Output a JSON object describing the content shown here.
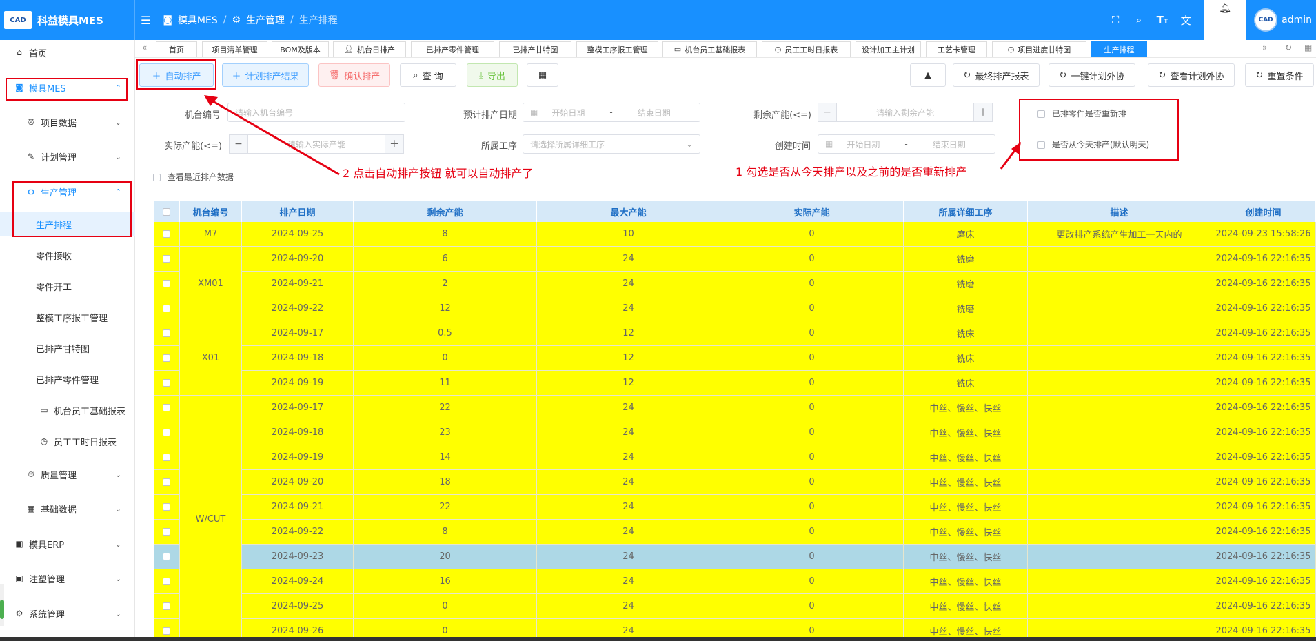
{
  "app": {
    "logo_mark": "CAD",
    "title": "科益模具MES",
    "user": "admin",
    "user_avatar": "CAD"
  },
  "breadcrumb": {
    "module": "模具MES",
    "section": "生产管理",
    "page": "生产排程"
  },
  "sidebar": {
    "home": "首页",
    "mes": "模具MES",
    "project_data": "项目数据",
    "plan_mgmt": "计划管理",
    "prod_mgmt": "生产管理",
    "prod_schedule": "生产排程",
    "part_receive": "零件接收",
    "part_start": "零件开工",
    "mold_report": "整模工序报工管理",
    "gantt": "已排产甘特图",
    "scheduled_parts": "已排产零件管理",
    "machine_staff": "机台员工基础报表",
    "staff_daily": "员工工时日报表",
    "quality": "质量管理",
    "basic_data": "基础数据",
    "erp": "模具ERP",
    "injection": "注塑管理",
    "system": "系统管理"
  },
  "tabs": [
    "首页",
    "项目清单管理",
    "BOM及版本",
    "机台日排产",
    "已排产零件管理",
    "已排产甘特图",
    "整模工序报工管理",
    "机台员工基础报表",
    "员工工时日报表",
    "设计加工主计划",
    "工艺卡管理",
    "项目进度甘特图",
    "生产排程"
  ],
  "toolbar": {
    "auto_schedule": "自动排产",
    "plan_result": "计划排产结果",
    "confirm": "确认排产",
    "query": "查 询",
    "export": "导出",
    "final_report": "最终排产报表",
    "outsource_one": "一键计划外协",
    "view_outsource": "查看计划外协",
    "reset": "重置条件"
  },
  "filters": {
    "machine_label": "机台编号",
    "machine_ph": "请输入机台编号",
    "date_label": "预计排产日期",
    "start_ph": "开始日期",
    "end_ph": "结束日期",
    "dash": "-",
    "remain_label": "剩余产能(<=)",
    "remain_ph": "请输入剩余产能",
    "actual_label": "实际产能(<=)",
    "actual_ph": "请输入实际产能",
    "process_label": "所属工序",
    "process_ph": "请选择所属详细工序",
    "create_label": "创建时间",
    "resched_label": "已排零件是否重新排",
    "today_label": "是否从今天排产(默认明天)",
    "recent_label": "查看最近排产数据"
  },
  "annotations": {
    "a1": "1 勾选是否从今天排产以及之前的是否重新排产",
    "a2": "2 点击自动排产按钮 就可以自动排产了"
  },
  "colors": {
    "primary": "#1890ff",
    "row_yellow": "#ffff00",
    "row_selected": "#add8e6",
    "annot": "#e60012"
  },
  "table": {
    "headers": [
      "机台编号",
      "排产日期",
      "剩余产能",
      "最大产能",
      "实际产能",
      "所属详细工序",
      "描述",
      "创建时间"
    ],
    "groups": [
      {
        "machine": "M7",
        "start": 0,
        "span": 1
      },
      {
        "machine": "XM01",
        "start": 1,
        "span": 3
      },
      {
        "machine": "X01",
        "start": 4,
        "span": 3
      },
      {
        "machine": "W/CUT",
        "start": 7,
        "span": 10
      }
    ],
    "rows": [
      {
        "date": "2024-09-25",
        "remain": "8",
        "max": "10",
        "actual": "0",
        "process": "磨床",
        "desc": "更改排产系统产生加工一天内的",
        "created": "2024-09-23 15:58:26"
      },
      {
        "date": "2024-09-20",
        "remain": "6",
        "max": "24",
        "actual": "0",
        "process": "铣磨",
        "desc": "",
        "created": "2024-09-16 22:16:35"
      },
      {
        "date": "2024-09-21",
        "remain": "2",
        "max": "24",
        "actual": "0",
        "process": "铣磨",
        "desc": "",
        "created": "2024-09-16 22:16:35"
      },
      {
        "date": "2024-09-22",
        "remain": "12",
        "max": "24",
        "actual": "0",
        "process": "铣磨",
        "desc": "",
        "created": "2024-09-16 22:16:35"
      },
      {
        "date": "2024-09-17",
        "remain": "0.5",
        "max": "12",
        "actual": "0",
        "process": "铣床",
        "desc": "",
        "created": "2024-09-16 22:16:35"
      },
      {
        "date": "2024-09-18",
        "remain": "0",
        "max": "12",
        "actual": "0",
        "process": "铣床",
        "desc": "",
        "created": "2024-09-16 22:16:35"
      },
      {
        "date": "2024-09-19",
        "remain": "11",
        "max": "12",
        "actual": "0",
        "process": "铣床",
        "desc": "",
        "created": "2024-09-16 22:16:35"
      },
      {
        "date": "2024-09-17",
        "remain": "22",
        "max": "24",
        "actual": "0",
        "process": "中丝、慢丝、快丝",
        "desc": "",
        "created": "2024-09-16 22:16:35"
      },
      {
        "date": "2024-09-18",
        "remain": "23",
        "max": "24",
        "actual": "0",
        "process": "中丝、慢丝、快丝",
        "desc": "",
        "created": "2024-09-16 22:16:35"
      },
      {
        "date": "2024-09-19",
        "remain": "14",
        "max": "24",
        "actual": "0",
        "process": "中丝、慢丝、快丝",
        "desc": "",
        "created": "2024-09-16 22:16:35"
      },
      {
        "date": "2024-09-20",
        "remain": "18",
        "max": "24",
        "actual": "0",
        "process": "中丝、慢丝、快丝",
        "desc": "",
        "created": "2024-09-16 22:16:35"
      },
      {
        "date": "2024-09-21",
        "remain": "22",
        "max": "24",
        "actual": "0",
        "process": "中丝、慢丝、快丝",
        "desc": "",
        "created": "2024-09-16 22:16:35"
      },
      {
        "date": "2024-09-22",
        "remain": "8",
        "max": "24",
        "actual": "0",
        "process": "中丝、慢丝、快丝",
        "desc": "",
        "created": "2024-09-16 22:16:35"
      },
      {
        "date": "2024-09-23",
        "remain": "20",
        "max": "24",
        "actual": "0",
        "process": "中丝、慢丝、快丝",
        "desc": "",
        "created": "2024-09-16 22:16:35",
        "selected": true
      },
      {
        "date": "2024-09-24",
        "remain": "16",
        "max": "24",
        "actual": "0",
        "process": "中丝、慢丝、快丝",
        "desc": "",
        "created": "2024-09-16 22:16:35"
      },
      {
        "date": "2024-09-25",
        "remain": "0",
        "max": "24",
        "actual": "0",
        "process": "中丝、慢丝、快丝",
        "desc": "",
        "created": "2024-09-16 22:16:35"
      },
      {
        "date": "2024-09-26",
        "remain": "0",
        "max": "24",
        "actual": "0",
        "process": "中丝、慢丝、快丝",
        "desc": "",
        "created": "2024-09-16 22:16:35"
      }
    ]
  }
}
